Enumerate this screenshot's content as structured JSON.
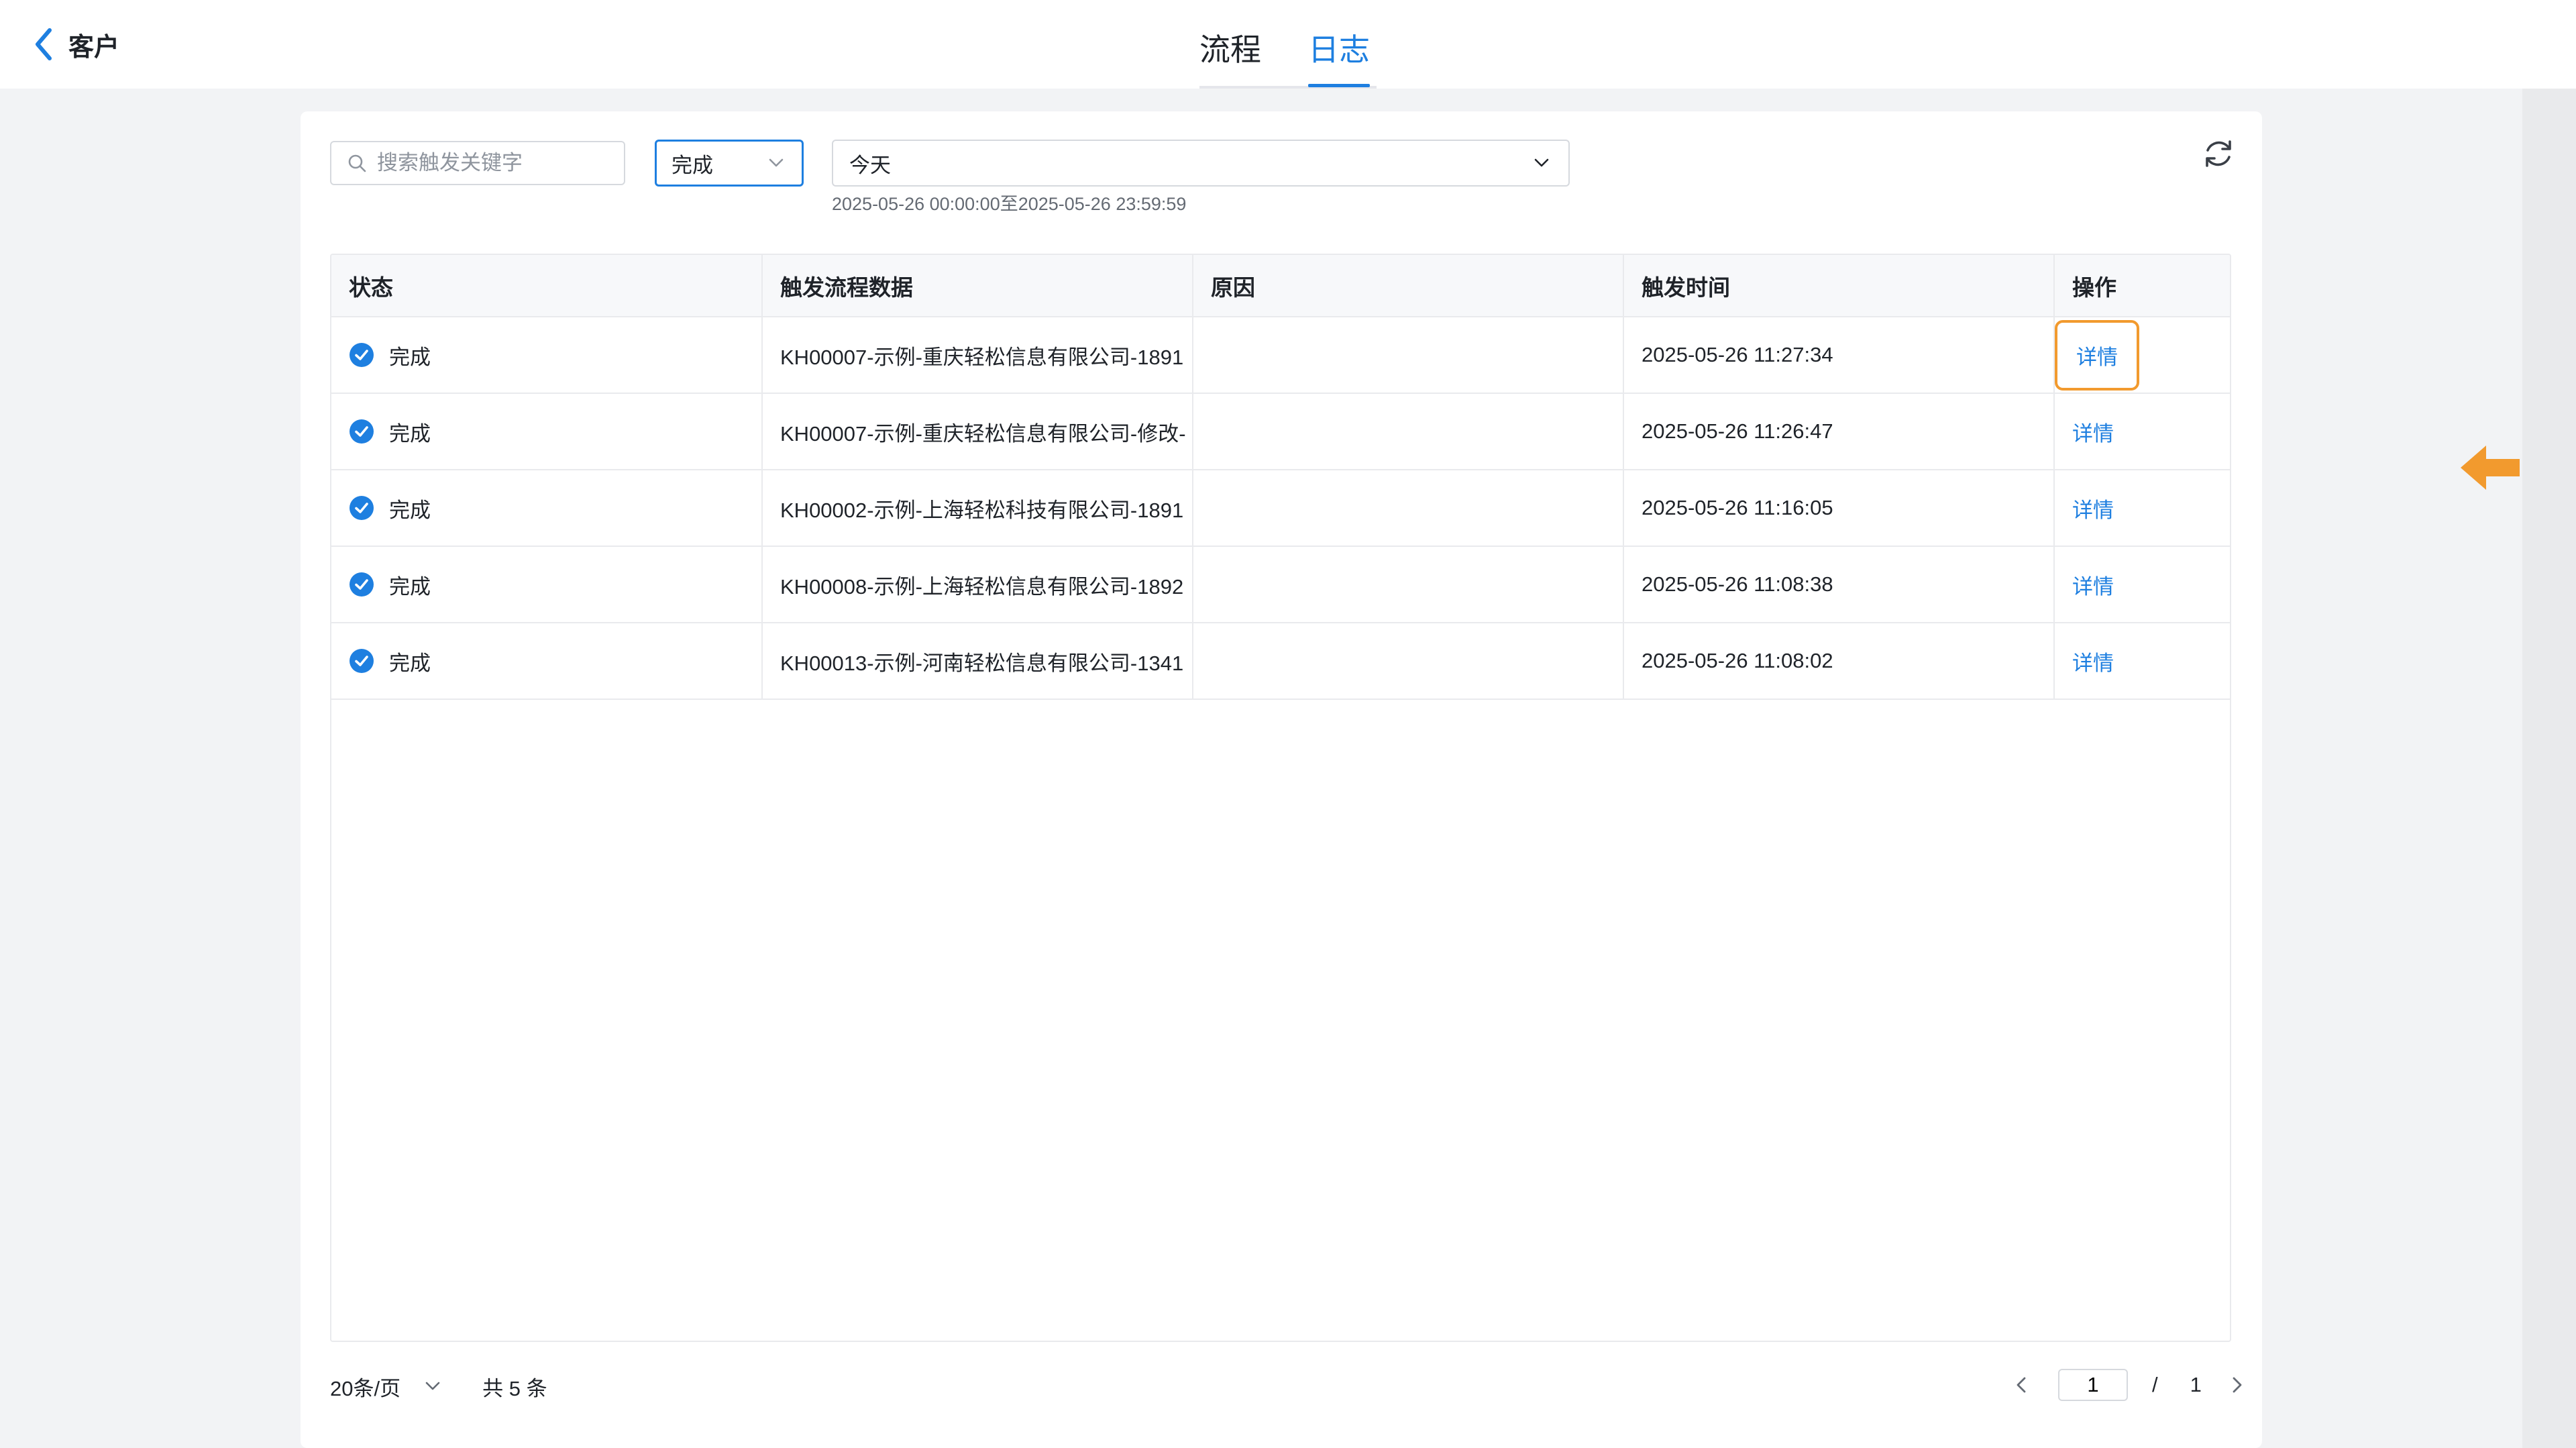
{
  "header": {
    "back_label": "客户",
    "tabs": [
      {
        "label": "流程",
        "active": false
      },
      {
        "label": "日志",
        "active": true
      }
    ]
  },
  "filters": {
    "search_placeholder": "搜索触发关键字",
    "status_value": "完成",
    "date_value": "今天",
    "date_range": "2025-05-26 00:00:00至2025-05-26 23:59:59"
  },
  "table": {
    "columns": [
      "状态",
      "触发流程数据",
      "原因",
      "触发时间",
      "操作"
    ],
    "rows": [
      {
        "status": "完成",
        "data": "KH00007-示例-重庆轻松信息有限公司-1891",
        "reason": "",
        "time": "2025-05-26 11:27:34",
        "action": "详情"
      },
      {
        "status": "完成",
        "data": "KH00007-示例-重庆轻松信息有限公司-修改-",
        "reason": "",
        "time": "2025-05-26 11:26:47",
        "action": "详情"
      },
      {
        "status": "完成",
        "data": "KH00002-示例-上海轻松科技有限公司-1891",
        "reason": "",
        "time": "2025-05-26 11:16:05",
        "action": "详情"
      },
      {
        "status": "完成",
        "data": "KH00008-示例-上海轻松信息有限公司-1892",
        "reason": "",
        "time": "2025-05-26 11:08:38",
        "action": "详情"
      },
      {
        "status": "完成",
        "data": "KH00013-示例-河南轻松信息有限公司-1341",
        "reason": "",
        "time": "2025-05-26 11:08:02",
        "action": "详情"
      }
    ]
  },
  "footer": {
    "page_size": "20条/页",
    "total": "共 5 条",
    "current_page": "1",
    "separator": "/",
    "total_pages": "1"
  },
  "colors": {
    "accent": "#1e7fe0",
    "highlight": "#f29a2e"
  },
  "icons": [
    "chevron-left-icon",
    "search-icon",
    "chevron-down-icon",
    "refresh-icon",
    "check-circle-icon",
    "arrow-left-icon",
    "chevron-right-icon"
  ]
}
